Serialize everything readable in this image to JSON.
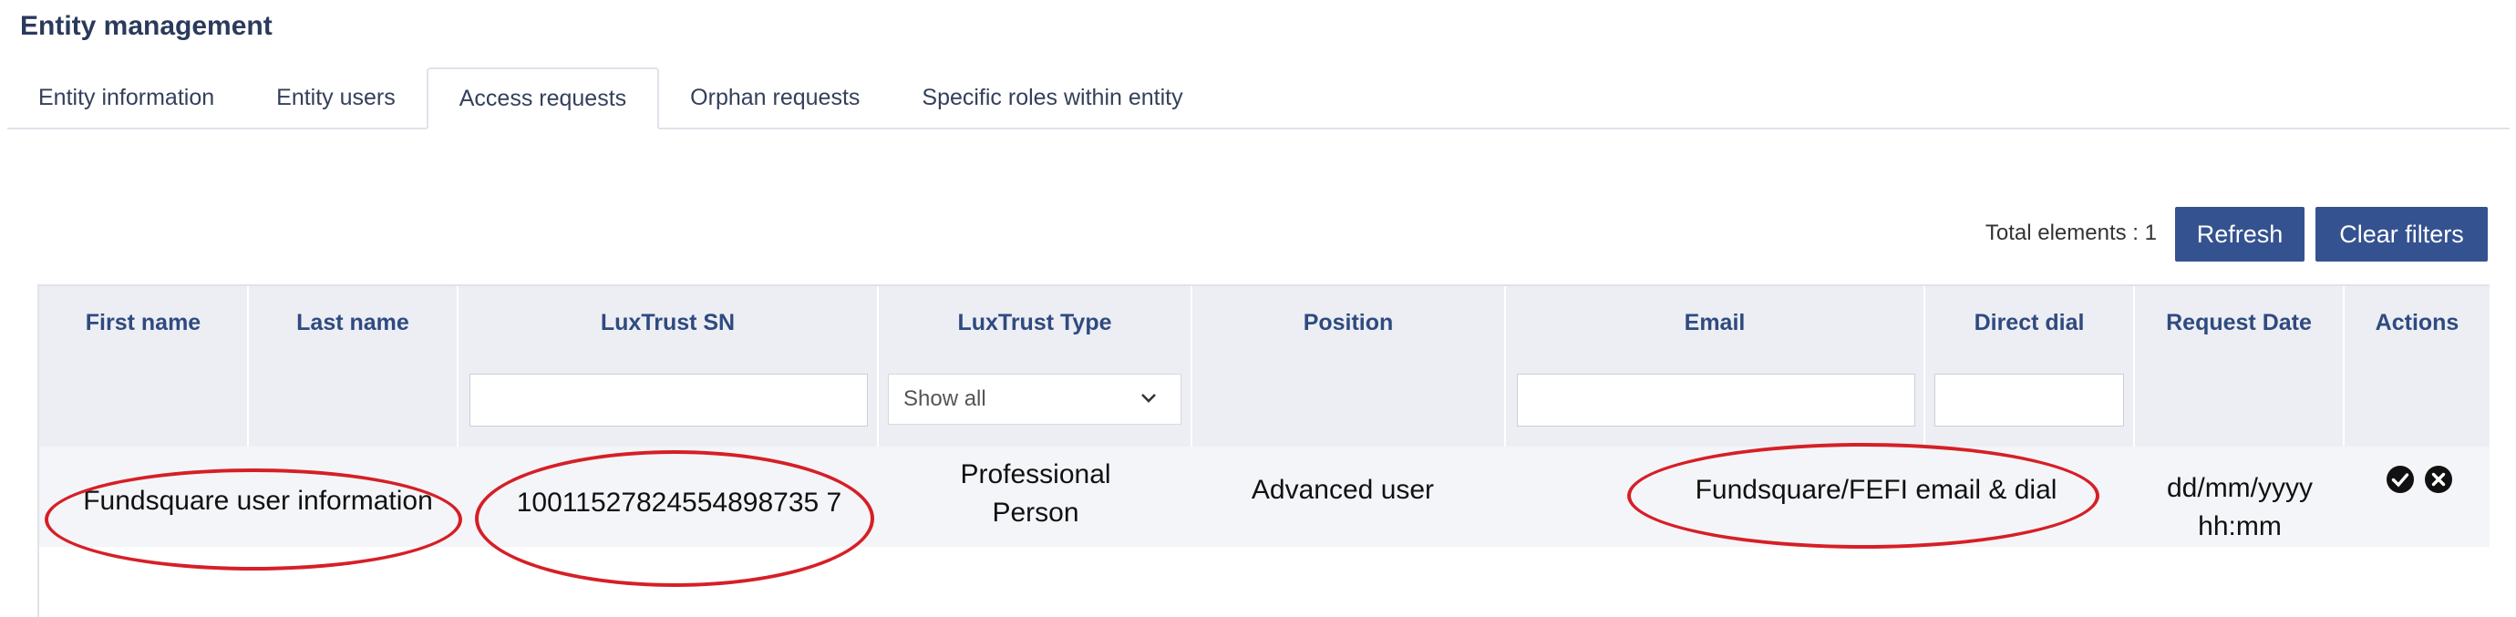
{
  "page": {
    "title": "Entity management"
  },
  "tabs": [
    {
      "label": "Entity information",
      "active": false
    },
    {
      "label": "Entity users",
      "active": false
    },
    {
      "label": "Access requests",
      "active": true
    },
    {
      "label": "Orphan requests",
      "active": false
    },
    {
      "label": "Specific roles within entity",
      "active": false
    }
  ],
  "toolbar": {
    "total_label": "Total elements : 1",
    "refresh_label": "Refresh",
    "clear_filters_label": "Clear filters"
  },
  "table": {
    "columns": [
      "First name",
      "Last name",
      "LuxTrust SN",
      "LuxTrust Type",
      "Position",
      "Email",
      "Direct dial",
      "Request Date",
      "Actions"
    ],
    "filters": {
      "luxtrust_sn": "",
      "luxtrust_type_selected": "Show all",
      "email": "",
      "direct_dial": ""
    },
    "rows": [
      {
        "name": "Fundsquare user information",
        "luxtrust_sn": "10011527824554898735 7",
        "luxtrust_type_line1": "Professional",
        "luxtrust_type_line2": "Person",
        "position": "Advanced user",
        "email_dial": "Fundsquare/FEFI email & dial",
        "request_date_line1": "dd/mm/yyyy",
        "request_date_line2": "hh:mm"
      }
    ]
  },
  "icons": {
    "approve": "check-circle-icon",
    "reject": "x-circle-icon",
    "dropdown": "chevron-down-icon"
  },
  "colors": {
    "accent": "#34528f",
    "header_text": "#2f4a80",
    "annotation": "#d61f26"
  }
}
